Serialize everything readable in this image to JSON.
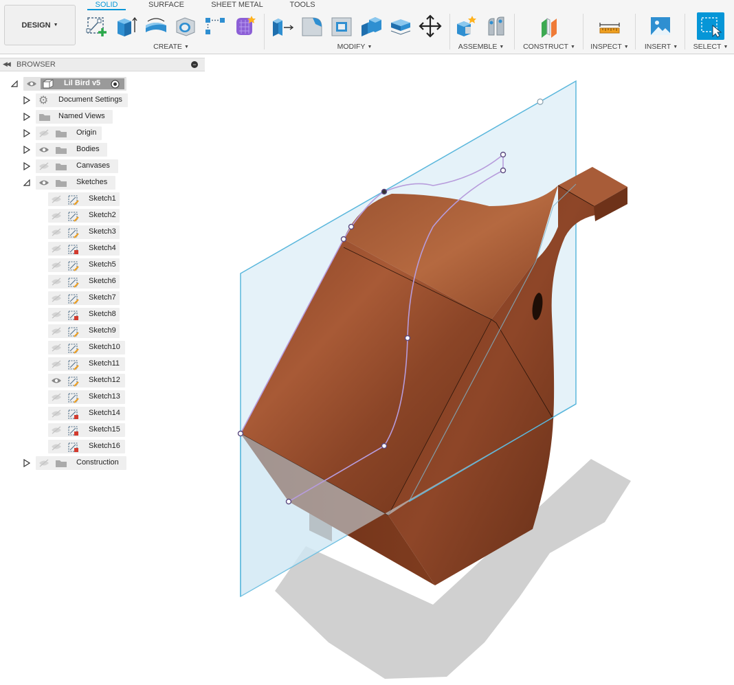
{
  "workspace": {
    "label": "DESIGN"
  },
  "tabs": [
    {
      "label": "SOLID",
      "active": true
    },
    {
      "label": "SURFACE",
      "active": false
    },
    {
      "label": "SHEET METAL",
      "active": false
    },
    {
      "label": "TOOLS",
      "active": false
    }
  ],
  "groups": {
    "create": "CREATE",
    "modify": "MODIFY",
    "assemble": "ASSEMBLE",
    "construct": "CONSTRUCT",
    "inspect": "INSPECT",
    "insert": "INSERT",
    "select": "SELECT"
  },
  "browser": {
    "title": "BROWSER",
    "root": {
      "label": "Lil Bird v5"
    },
    "folders": {
      "document_settings": "Document Settings",
      "named_views": "Named Views",
      "origin": "Origin",
      "bodies": "Bodies",
      "canvases": "Canvases",
      "sketches": "Sketches",
      "construction": "Construction"
    },
    "sketches": [
      {
        "label": "Sketch1",
        "visible": false
      },
      {
        "label": "Sketch2",
        "visible": false
      },
      {
        "label": "Sketch3",
        "visible": false
      },
      {
        "label": "Sketch4",
        "visible": false
      },
      {
        "label": "Sketch5",
        "visible": false
      },
      {
        "label": "Sketch6",
        "visible": false
      },
      {
        "label": "Sketch7",
        "visible": false
      },
      {
        "label": "Sketch8",
        "visible": false
      },
      {
        "label": "Sketch9",
        "visible": false
      },
      {
        "label": "Sketch10",
        "visible": false
      },
      {
        "label": "Sketch11",
        "visible": false
      },
      {
        "label": "Sketch12",
        "visible": true
      },
      {
        "label": "Sketch13",
        "visible": false
      },
      {
        "label": "Sketch14",
        "visible": false
      },
      {
        "label": "Sketch15",
        "visible": false
      },
      {
        "label": "Sketch16",
        "visible": false
      }
    ]
  },
  "colors": {
    "accent": "#0696d7",
    "wood_light": "#a85a36",
    "wood_dark": "#6e3219",
    "plane_stroke": "#5ab7dc",
    "sketch_curve": "#b79cdc"
  }
}
